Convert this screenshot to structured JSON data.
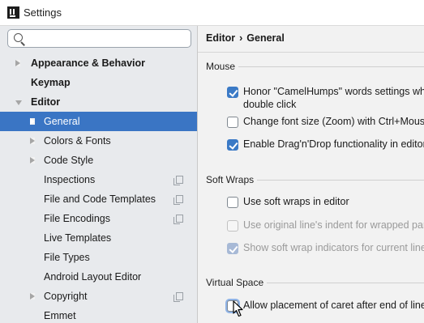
{
  "window": {
    "title": "Settings"
  },
  "search": {
    "placeholder": ""
  },
  "tree": [
    {
      "label": "Appearance & Behavior",
      "bold": true,
      "arrow": "right",
      "indent": 0
    },
    {
      "label": "Keymap",
      "bold": true,
      "arrow": "none",
      "indent": 0
    },
    {
      "label": "Editor",
      "bold": true,
      "arrow": "down",
      "indent": 0
    },
    {
      "label": "General",
      "bold": false,
      "arrow": "right",
      "indent": 1,
      "selected": true
    },
    {
      "label": "Colors & Fonts",
      "bold": false,
      "arrow": "right",
      "indent": 1
    },
    {
      "label": "Code Style",
      "bold": false,
      "arrow": "right",
      "indent": 1
    },
    {
      "label": "Inspections",
      "bold": false,
      "arrow": "none",
      "indent": 1,
      "copy": true
    },
    {
      "label": "File and Code Templates",
      "bold": false,
      "arrow": "none",
      "indent": 1,
      "copy": true
    },
    {
      "label": "File Encodings",
      "bold": false,
      "arrow": "none",
      "indent": 1,
      "copy": true
    },
    {
      "label": "Live Templates",
      "bold": false,
      "arrow": "none",
      "indent": 1
    },
    {
      "label": "File Types",
      "bold": false,
      "arrow": "none",
      "indent": 1
    },
    {
      "label": "Android Layout Editor",
      "bold": false,
      "arrow": "none",
      "indent": 1
    },
    {
      "label": "Copyright",
      "bold": false,
      "arrow": "right",
      "indent": 1,
      "copy": true
    },
    {
      "label": "Emmet",
      "bold": false,
      "arrow": "none",
      "indent": 1
    }
  ],
  "breadcrumb": {
    "parent": "Editor",
    "separator": "›",
    "current": "General"
  },
  "sections": {
    "mouse": {
      "label": "Mouse",
      "options": [
        {
          "line1": "Honor \"CamelHumps\" words settings when",
          "line2": "double click",
          "checked": true
        },
        {
          "line1": "Change font size (Zoom) with Ctrl+Mouse",
          "checked": false
        },
        {
          "line1": "Enable Drag'n'Drop functionality in editor",
          "checked": true
        }
      ]
    },
    "soft_wraps": {
      "label": "Soft Wraps",
      "options": [
        {
          "line1": "Use soft wraps in editor",
          "checked": false
        },
        {
          "line1": "Use original line's indent for wrapped parts",
          "checked": false,
          "disabled": true
        },
        {
          "line1": "Show soft wrap indicators for current line o",
          "checked": true,
          "disabled": true
        }
      ]
    },
    "virtual_space": {
      "label": "Virtual Space",
      "options": [
        {
          "line1": "Allow placement of caret after end of line",
          "checked": false,
          "focused": true
        }
      ]
    }
  },
  "colors": {
    "selection": "#3a75c4",
    "checkbox": "#3b7ac6",
    "panel_left": "#e8eaed",
    "panel_right": "#f2f2f2"
  }
}
